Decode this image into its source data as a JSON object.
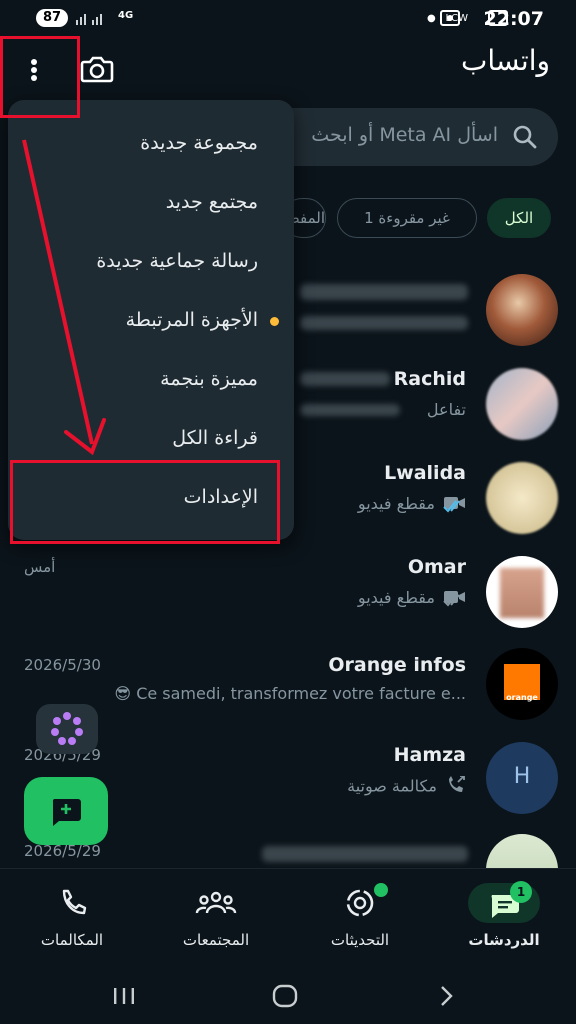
{
  "status_bar": {
    "badge": "87",
    "network": "4G",
    "carrier_tag": "LCW",
    "time": "22:07"
  },
  "header": {
    "title": "واتساب",
    "camera_icon": "camera-icon",
    "menu_icon": "more-vertical-icon"
  },
  "search": {
    "placeholder": "اسأل Meta AI أو ابحث"
  },
  "filters": [
    {
      "label": "الكل",
      "active": true
    },
    {
      "label": "غير مقروءة 1",
      "active": false
    },
    {
      "label": "المفضلة",
      "active": false
    }
  ],
  "menu": {
    "items": [
      "مجموعة جديدة",
      "مجتمع جديد",
      "رسالة جماعية جديدة",
      "الأجهزة المرتبطة",
      "مميزة بنجمة",
      "قراءة الكل",
      "الإعدادات"
    ]
  },
  "chats": [
    {
      "name": "",
      "preview": "",
      "time": ""
    },
    {
      "name": "Rachid",
      "preview": "تفاعل",
      "time": ""
    },
    {
      "name": "Lwalida",
      "preview": "مقطع فيديو",
      "time": ""
    },
    {
      "name": "Omar",
      "preview": "مقطع فيديو",
      "time": "أمس"
    },
    {
      "name": "Orange infos",
      "preview": "Ce samedi, transformez votre facture e...",
      "emoji": "😎",
      "time": "2026/5/30",
      "avatar_text": "orange"
    },
    {
      "name": "Hamza",
      "preview": "مكالمة صوتية",
      "time": "2026/5/29",
      "avatar_text": "H"
    },
    {
      "name": "",
      "preview": "",
      "time": "2026/5/29"
    }
  ],
  "bottom_nav": {
    "chats": "الدردشات",
    "chats_badge": "1",
    "updates": "التحديثات",
    "communities": "المجتمعات",
    "calls": "المكالمات"
  },
  "colors": {
    "background": "#0b141a",
    "accent_green": "#21c063",
    "annotation_red": "#e8112d"
  }
}
